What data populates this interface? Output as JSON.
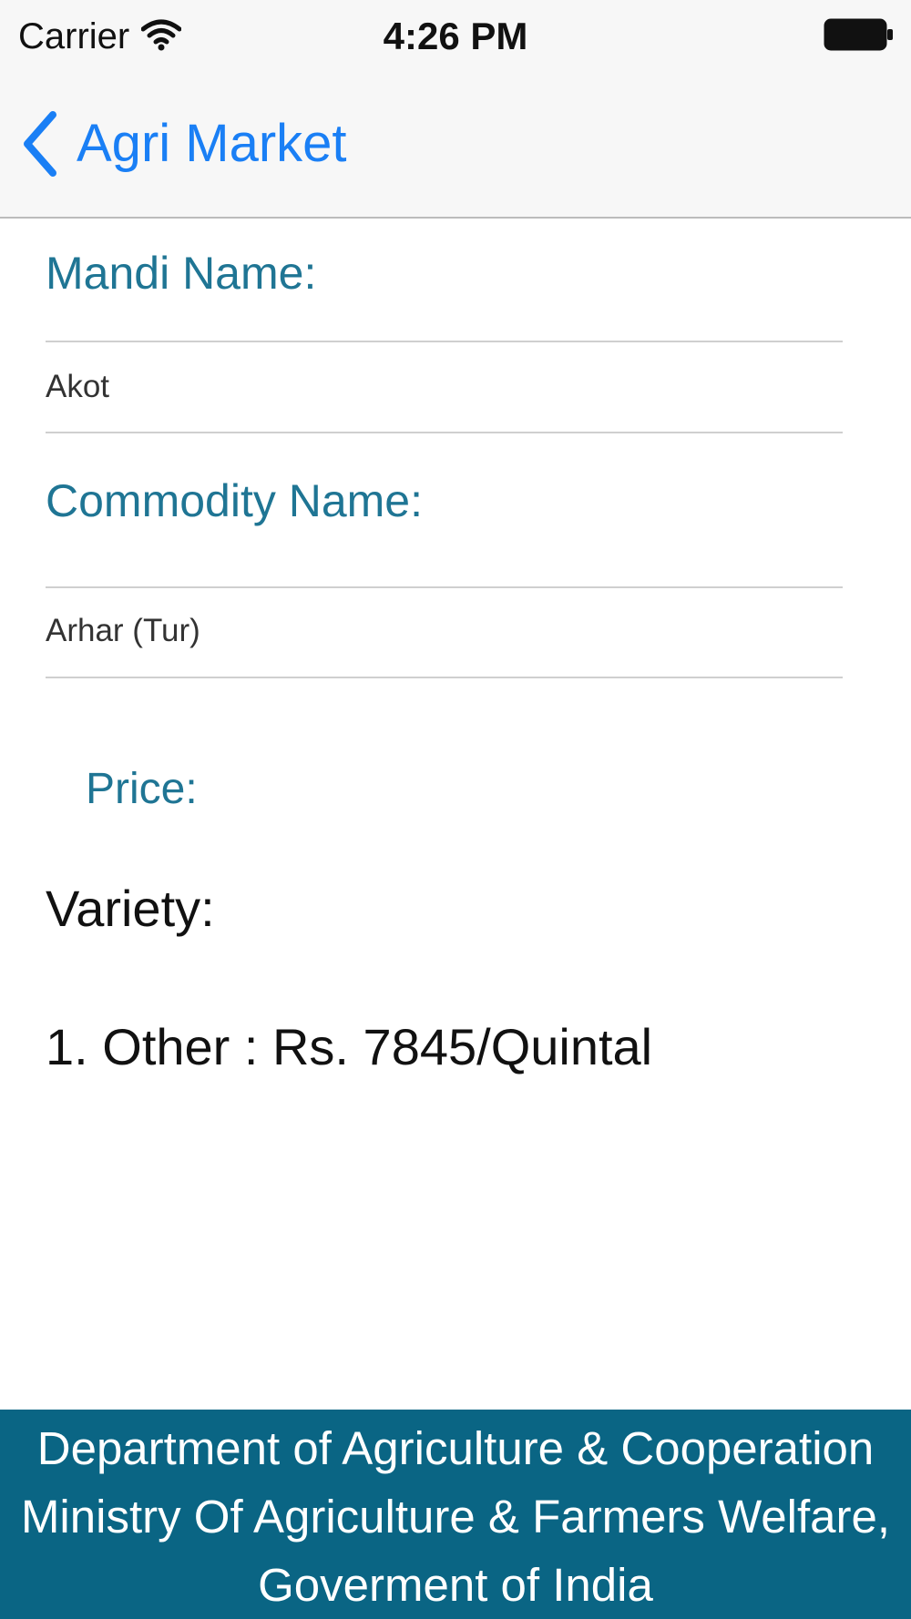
{
  "status_bar": {
    "carrier": "Carrier",
    "time": "4:26 PM",
    "icons": [
      "wifi-icon",
      "battery-icon"
    ]
  },
  "nav": {
    "back_label": "Agri Market",
    "back_icon": "chevron-left-icon",
    "accent_color": "#1a7ff5"
  },
  "form": {
    "mandi_title": "Mandi Name:",
    "mandi_value": "Akot",
    "commodity_title": "Commodity Name:",
    "commodity_value": "Arhar (Tur)",
    "label_color": "#1f7594"
  },
  "price": {
    "title": "Price:",
    "variety_title": "Variety:",
    "varieties": [
      "1. Other : Rs. 7845/Quintal"
    ]
  },
  "footer": {
    "line1": "Department of Agriculture & Cooperation",
    "line2": "Ministry Of Agriculture & Farmers Welfare,",
    "line3": "Goverment of India",
    "background": "#0a6584"
  }
}
